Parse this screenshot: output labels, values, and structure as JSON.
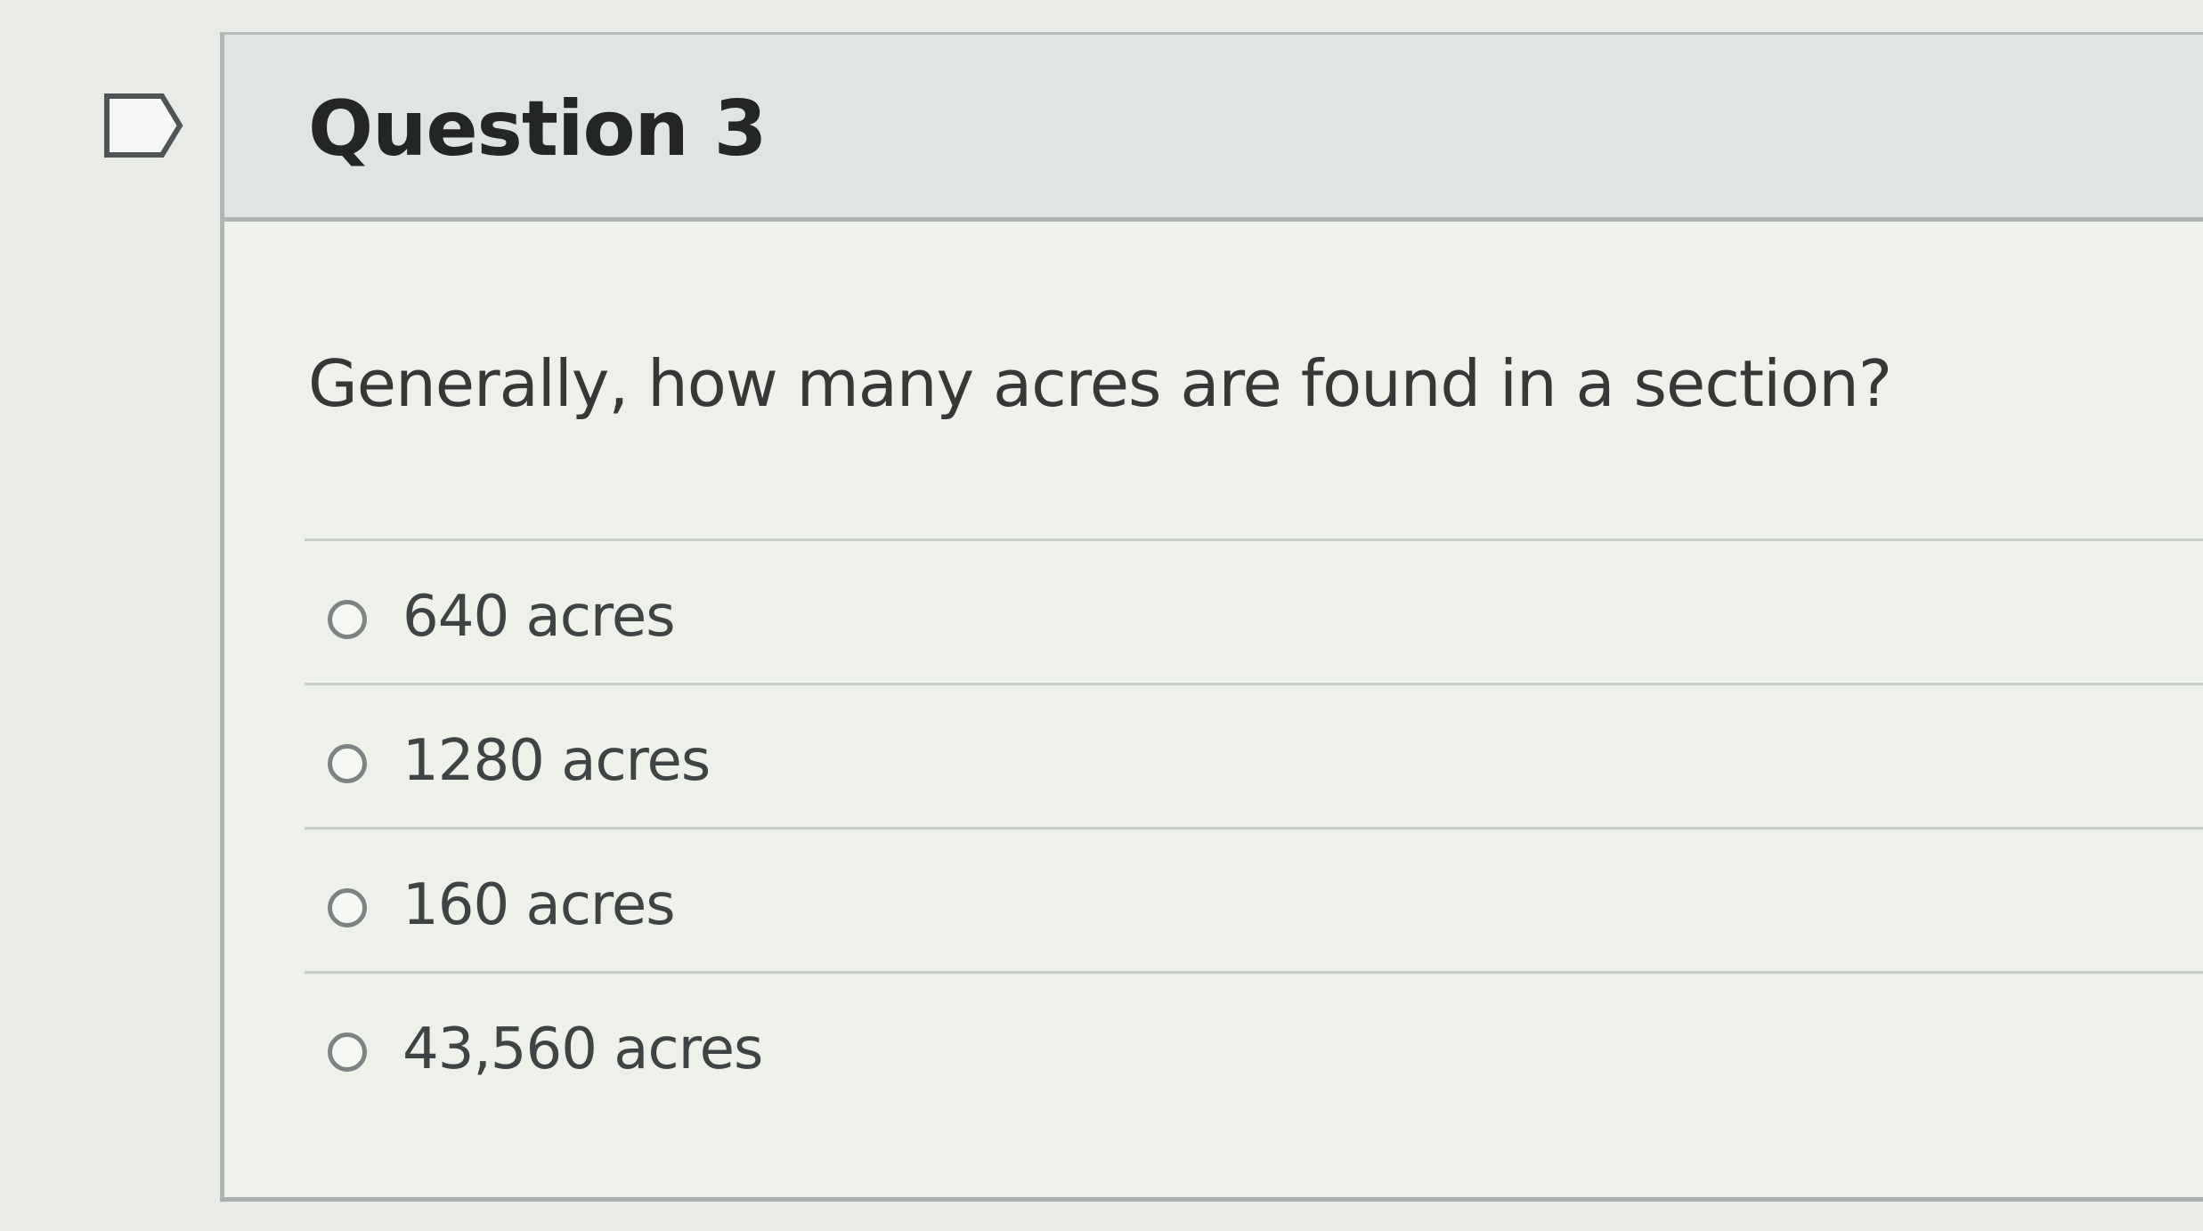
{
  "question": {
    "title": "Question 3",
    "text": "Generally, how many acres are found in a section?",
    "answers": [
      {
        "label": "640 acres",
        "selected": false
      },
      {
        "label": "1280 acres",
        "selected": false
      },
      {
        "label": "160 acres",
        "selected": false
      },
      {
        "label": "43,560 acres",
        "selected": false
      }
    ]
  },
  "icons": {
    "flag": "flag-icon",
    "radio": "radio-button-icon"
  },
  "colors": {
    "header_background": "#dfe5e3",
    "page_background": "#e9ece6",
    "border": "#aeb5b3",
    "text": "#363838"
  }
}
